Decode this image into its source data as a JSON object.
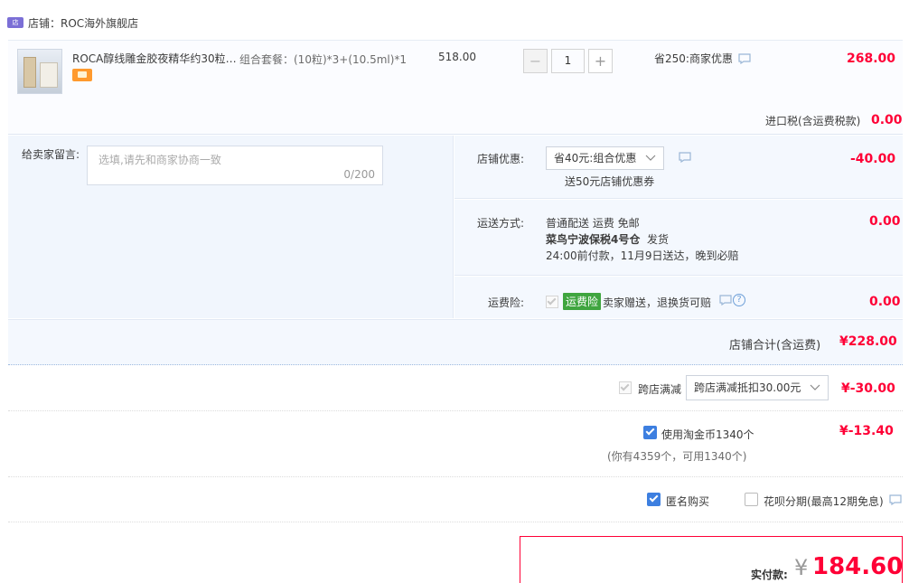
{
  "store": {
    "name": "店铺：ROC海外旗舰店",
    "badge_icon": "store-badge-icon"
  },
  "item": {
    "title": "ROCA醇线雕金胶夜精华约30粒…",
    "sku": "组合套餐：(10粒)*3+(10.5ml)*1",
    "unit_price": "518.00",
    "qty": "1",
    "qty_minus": "−",
    "qty_plus": "+",
    "discount": "省250:商家优惠",
    "total": "268.00"
  },
  "tax": {
    "label": "进口税(含运费税款)",
    "value": "0.00"
  },
  "message": {
    "label": "给卖家留言:",
    "placeholder": "选填,请先和商家协商一致",
    "count": "0/200"
  },
  "promo": {
    "label": "店铺优惠:",
    "selected": "省40元:组合优惠",
    "sub": "送50元店铺优惠券",
    "value": "-40.00"
  },
  "shipping": {
    "label": "运送方式:",
    "method": "普通配送 运费 免邮",
    "warehouse": "菜鸟宁波保税4号仓",
    "dispatch": "发货",
    "eta": "24:00前付款，11月9日送达，晚到必赔",
    "value": "0.00"
  },
  "insurance": {
    "label": "运费险:",
    "tag": "运费险",
    "text": "卖家赠送，退换货可赔",
    "value": "0.00"
  },
  "subtotal": {
    "label": "店铺合计(含运费)",
    "value": "¥228.00"
  },
  "cross_store": {
    "label": "跨店满减",
    "selected": "跨店满减抵扣30.00元",
    "value": "¥-30.00"
  },
  "coins": {
    "label": "使用淘金币1340个",
    "sub": "(你有4359个，可用1340个)",
    "value": "¥-13.40"
  },
  "options": {
    "anonymous": "匿名购买",
    "huabei": "花呗分期(最高12期免息)"
  },
  "pay": {
    "label": "实付款:",
    "currency": "¥",
    "value": "184.60"
  },
  "colors": {
    "price_red": "#ff0036",
    "check_blue": "#3d7fe0",
    "tag_green": "#3fa53f"
  }
}
